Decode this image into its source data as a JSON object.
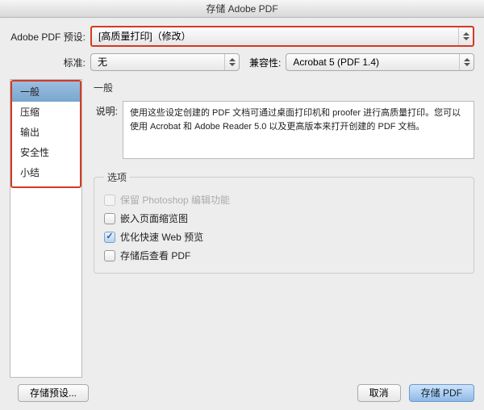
{
  "window": {
    "title": "存储 Adobe PDF"
  },
  "preset": {
    "label": "Adobe PDF 预设:",
    "value": "[高质量打印]（修改）"
  },
  "standard": {
    "label": "标准:",
    "value": "无"
  },
  "compat": {
    "label": "兼容性:",
    "value": "Acrobat 5 (PDF 1.4)"
  },
  "sidebar": {
    "items": [
      "一般",
      "压缩",
      "输出",
      "安全性",
      "小结"
    ],
    "selected": 0
  },
  "general": {
    "heading": "一般",
    "desc_label": "说明:",
    "description": "使用这些设定创建的 PDF 文档可通过桌面打印机和 proofer 进行高质量打印。您可以使用 Acrobat 和 Adobe Reader 5.0 以及更高版本来打开创建的 PDF 文档。",
    "options_legend": "选项",
    "options": [
      {
        "label": "保留 Photoshop 编辑功能",
        "checked": false,
        "disabled": true
      },
      {
        "label": "嵌入页面缩览图",
        "checked": false,
        "disabled": false
      },
      {
        "label": "优化快速 Web 预览",
        "checked": true,
        "disabled": false
      },
      {
        "label": "存储后查看 PDF",
        "checked": false,
        "disabled": false
      }
    ]
  },
  "footer": {
    "save_preset": "存储预设...",
    "cancel": "取消",
    "save_pdf": "存储 PDF"
  }
}
